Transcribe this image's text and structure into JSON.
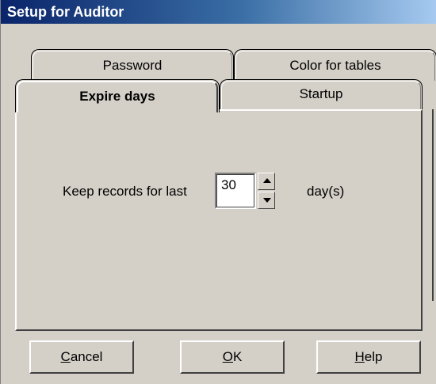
{
  "window": {
    "title": "Setup for Auditor"
  },
  "tabs": {
    "back_row": [
      {
        "label": "Password"
      },
      {
        "label": "Color for tables"
      }
    ],
    "front_row": [
      {
        "label": "Expire days",
        "selected": true
      },
      {
        "label": "Startup",
        "selected": false
      }
    ]
  },
  "expire_days": {
    "keep_label": "Keep records for last",
    "days_value": "30",
    "unit_label": "day(s)",
    "spinner_up_icon": "spin-up-arrow",
    "spinner_down_icon": "spin-down-arrow"
  },
  "buttons": {
    "cancel": {
      "mnemonic": "C",
      "rest": "ancel"
    },
    "ok": {
      "mnemonic": "O",
      "rest": "K"
    },
    "help": {
      "mnemonic": "H",
      "rest": "elp"
    }
  }
}
